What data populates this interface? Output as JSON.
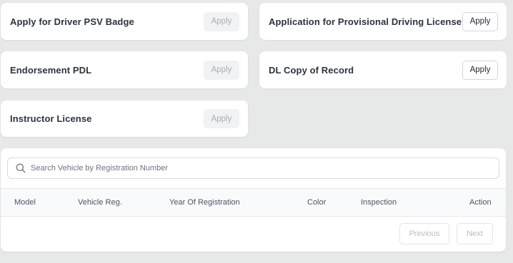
{
  "services": [
    {
      "title": "Apply for Driver PSV Badge",
      "button": "Apply",
      "state": "disabled"
    },
    {
      "title": "Application for Provisional Driving License",
      "button": "Apply",
      "state": "enabled"
    },
    {
      "title": "Endorsement PDL",
      "button": "Apply",
      "state": "disabled"
    },
    {
      "title": "DL Copy of Record",
      "button": "Apply",
      "state": "enabled"
    },
    {
      "title": "Instructor License",
      "button": "Apply",
      "state": "disabled"
    }
  ],
  "vehicles": {
    "search": {
      "placeholder": "Search Vehicle by Registration Number",
      "icon": "search-icon"
    },
    "columns": [
      "Model",
      "Vehicle Reg.",
      "Year Of Registration",
      "Color",
      "Inspection",
      "Action"
    ],
    "rows": [],
    "pagination": {
      "previous": "Previous",
      "next": "Next"
    }
  },
  "colors": {
    "background": "#e7e9e8",
    "card": "#ffffff",
    "disabled_button_bg": "#f1f2f4",
    "disabled_button_text": "#a7adb6"
  }
}
